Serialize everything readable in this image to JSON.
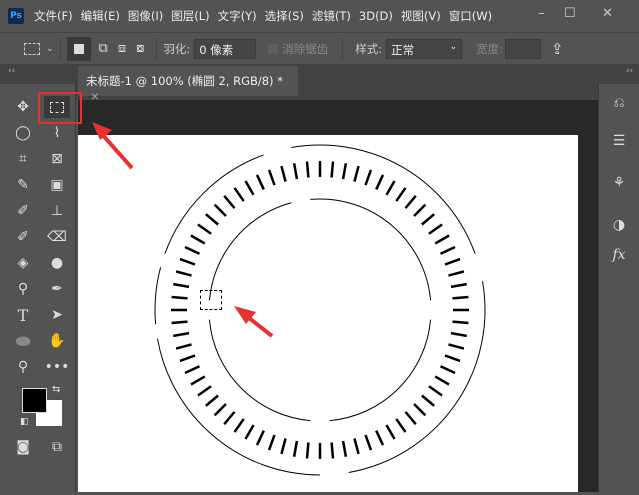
{
  "app": {
    "logo": "Ps"
  },
  "menu": [
    "文件(F)",
    "编辑(E)",
    "图像(I)",
    "图层(L)",
    "文字(Y)",
    "选择(S)",
    "滤镜(T)",
    "3D(D)",
    "视图(V)",
    "窗口(W)"
  ],
  "window_controls": {
    "minimize": "–",
    "maximize": "☐",
    "close": "✕"
  },
  "options": {
    "feather_label": "羽化:",
    "feather_value": "0 像素",
    "antialias_label": "消除锯齿",
    "style_label": "样式:",
    "style_value": "正常",
    "width_label": "宽度:"
  },
  "document": {
    "tab_title": "未标题-1 @ 100% (椭圆 2, RGB/8) *",
    "close": "×"
  },
  "colors": {
    "foreground": "#000000",
    "background": "#ffffff",
    "highlight": "#e8312f"
  },
  "tools": [
    "move",
    "rect-marquee",
    "lasso",
    "quick-select",
    "crop",
    "frame",
    "eyedropper",
    "patch",
    "brush",
    "stamp",
    "history-brush",
    "eraser",
    "paint-bucket",
    "blur",
    "dodge",
    "pen",
    "type",
    "path-select",
    "ellipse",
    "hand",
    "zoom",
    "more"
  ],
  "collapse": "‹‹"
}
